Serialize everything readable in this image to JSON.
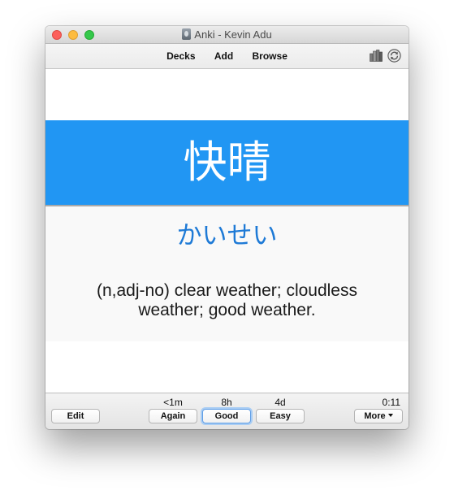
{
  "window": {
    "title": "Anki - Kevin Adu"
  },
  "toolbar": {
    "nav": [
      "Decks",
      "Add",
      "Browse"
    ],
    "icons": [
      "stats-icon",
      "sync-icon"
    ]
  },
  "card": {
    "front": "快晴",
    "reading": "かいせい",
    "meaning": "(n,adj-no) clear weather; cloudless weather; good weather.",
    "colors": {
      "front_background": "#2196f3",
      "front_text": "#ffffff",
      "reading_text": "#1e7ad6",
      "back_background": "#f9f9f9"
    }
  },
  "bottom": {
    "edit_label": "Edit",
    "answers": [
      {
        "interval": "<1m",
        "label": "Again"
      },
      {
        "interval": "8h",
        "label": "Good"
      },
      {
        "interval": "4d",
        "label": "Easy"
      }
    ],
    "timer": "0:11",
    "more_label": "More"
  }
}
